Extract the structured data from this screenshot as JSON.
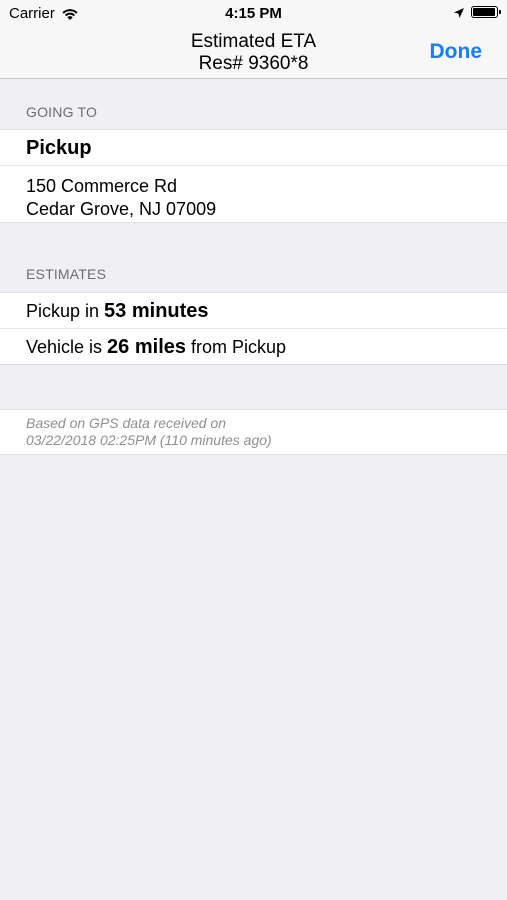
{
  "status_bar": {
    "carrier": "Carrier",
    "time": "4:15 PM",
    "battery_level": 0.95
  },
  "nav": {
    "title_line1": "Estimated ETA",
    "title_line2": "Res# 9360*8",
    "done_label": "Done",
    "accent_color": "#147efb"
  },
  "going_to": {
    "header": "GOING TO",
    "location_name": "Pickup",
    "address_line1": "150 Commerce Rd",
    "address_line2": "Cedar Grove, NJ 07009"
  },
  "estimates": {
    "header": "ESTIMATES",
    "pickup_prefix": "Pickup in ",
    "pickup_value": "53 minutes",
    "vehicle_prefix": "Vehicle is ",
    "vehicle_value": "26 miles",
    "vehicle_suffix": " from Pickup"
  },
  "footer": {
    "line1": "Based on GPS data received on",
    "line2": "03/22/2018 02:25PM (110 minutes ago)"
  }
}
